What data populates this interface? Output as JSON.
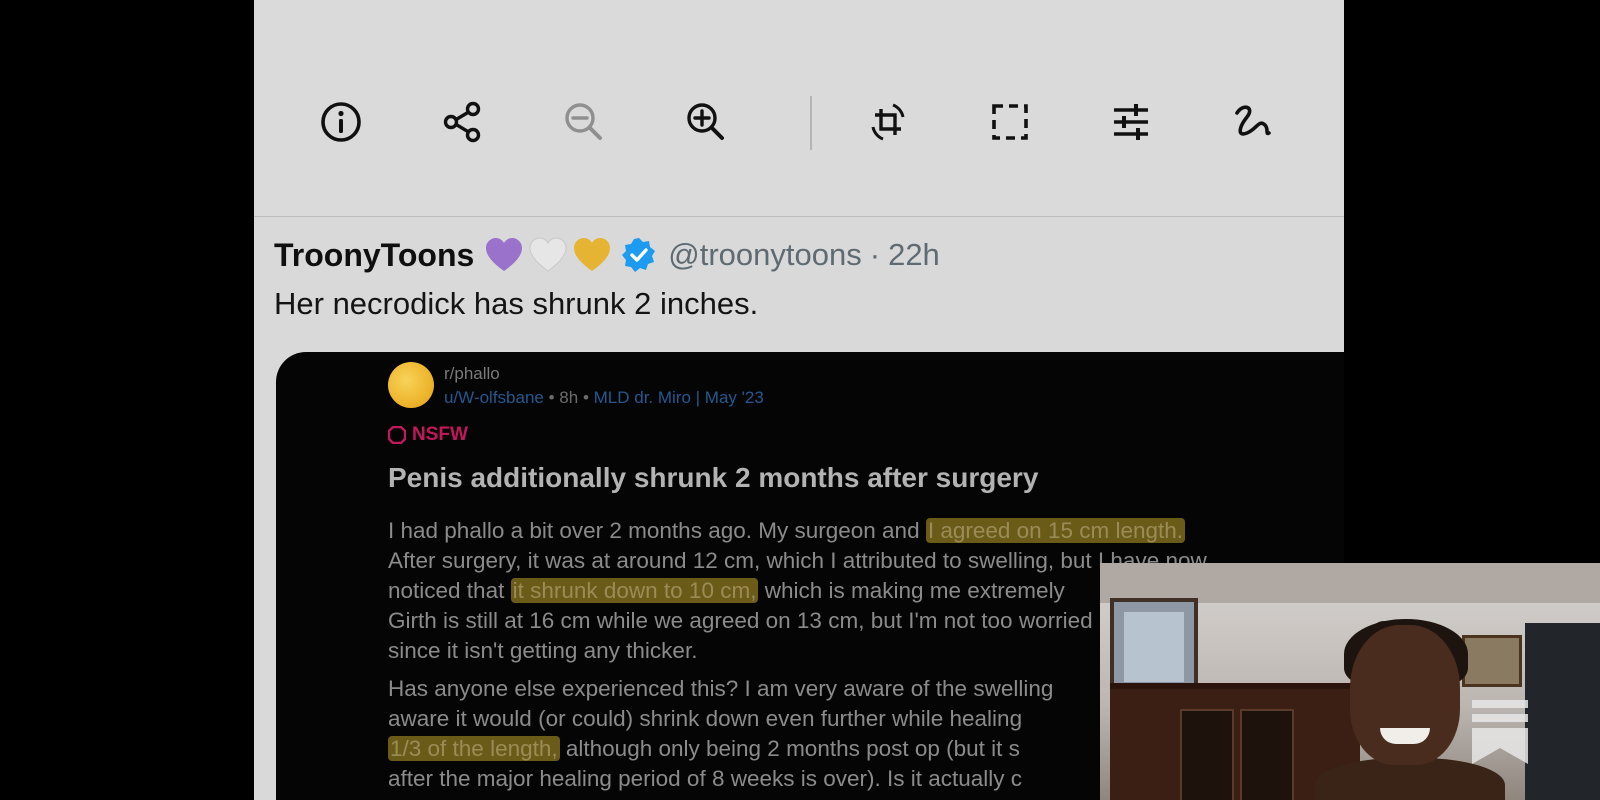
{
  "toolbar": {
    "tools": [
      {
        "id": "info",
        "icon": "info-icon",
        "label": "Info"
      },
      {
        "id": "share",
        "icon": "share-icon",
        "label": "Share"
      },
      {
        "id": "zoom-out",
        "icon": "zoom-out-icon",
        "label": "Zoom out",
        "disabled": true
      },
      {
        "id": "zoom-in",
        "icon": "zoom-in-icon",
        "label": "Zoom in"
      },
      {
        "id": "crop-rotate",
        "icon": "crop-rotate-icon",
        "label": "Crop and rotate"
      },
      {
        "id": "select",
        "icon": "selection-icon",
        "label": "Select"
      },
      {
        "id": "adjust",
        "icon": "sliders-icon",
        "label": "Adjust"
      },
      {
        "id": "markup",
        "icon": "squiggle-pen-icon",
        "label": "Markup"
      }
    ]
  },
  "tweet": {
    "author": "TroonyToons",
    "hearts": [
      "#9a72cc",
      "#e6e6e6",
      "#e6b433"
    ],
    "verified_color": "#1d9bf0",
    "handle": "@troonytoons",
    "separator": "·",
    "time": "22h",
    "text": "Her necrodick has shrunk 2 inches."
  },
  "embed": {
    "subreddit": "r/phallo",
    "user": "u/W-olfsbane",
    "age": "8h",
    "flair": "MLD dr. Miro | May '23",
    "nsfw_label": "NSFW",
    "nsfw_color": "#c2185b",
    "title": "Penis additionally shrunk 2 months after surgery",
    "highlight_color": "#6b5b19",
    "p1": {
      "l1a": "I had phallo a bit over 2 months ago. My surgeon and ",
      "l1b": "I agreed on 15 cm length.",
      "l2": "After surgery, it was at around 12 cm, which I attributed to swelling, but I have now",
      "l3a": "noticed that ",
      "l3b": "it shrunk down to 10 cm,",
      "l3c": " which is making me extremely",
      "l4": "Girth is still at 16 cm while we agreed on 13 cm, but I'm not too worried",
      "l5": "since it isn't getting any thicker."
    },
    "p2": {
      "l1": "Has anyone else experienced this? I am very aware of the swelling",
      "l2": "aware it would (or could) shrink down even further while healing",
      "l3a": "1/3 of the length,",
      "l3b": " although only being 2 months post op (but it s",
      "l4": "after the major healing period of 8 weeks is over). Is it actually c"
    }
  },
  "webcam": {
    "logo_icon": "substack-bookmark-icon"
  }
}
